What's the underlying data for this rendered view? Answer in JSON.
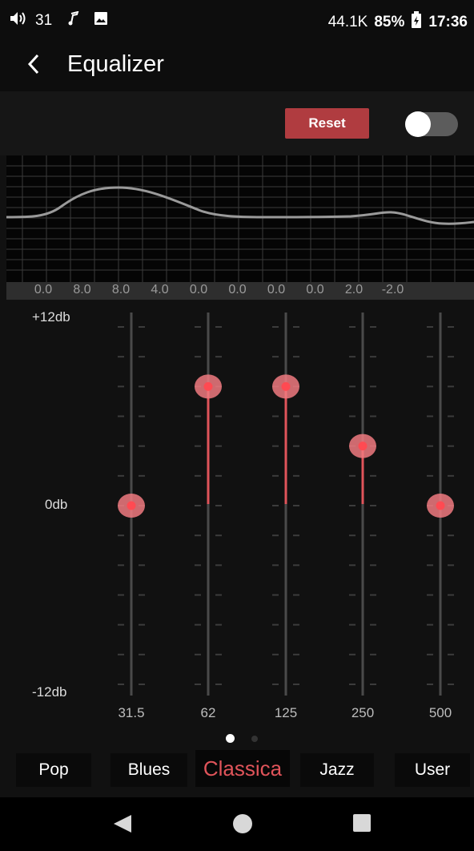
{
  "status_bar": {
    "volume_level": "31",
    "network_rate": "44.1K",
    "battery_percent": "85%",
    "time": "17:36",
    "icons": [
      "volume-icon",
      "music-note-icon",
      "image-icon",
      "battery-charging-icon"
    ]
  },
  "app_bar": {
    "title": "Equalizer",
    "back_icon": "chevron-left-icon"
  },
  "controls": {
    "reset_label": "Reset",
    "eq_enabled": false
  },
  "eq_curve": {
    "gain_labels": [
      "0.0",
      "8.0",
      "8.0",
      "4.0",
      "0.0",
      "0.0",
      "0.0",
      "0.0",
      "2.0",
      "-2.0"
    ]
  },
  "scale": {
    "max_label": "+12db",
    "mid_label": "0db",
    "min_label": "-12db",
    "max_db": 12,
    "min_db": -12
  },
  "bands": [
    {
      "freq": "31.5",
      "gain_db": 0
    },
    {
      "freq": "62",
      "gain_db": 8
    },
    {
      "freq": "125",
      "gain_db": 8
    },
    {
      "freq": "250",
      "gain_db": 4
    },
    {
      "freq": "500",
      "gain_db": 0
    }
  ],
  "pager": {
    "pages": 2,
    "current": 0
  },
  "presets": {
    "items": [
      "Pop",
      "Blues",
      "Classica",
      "Jazz",
      "User"
    ],
    "selected_index": 2
  },
  "colors": {
    "accent": "#e0545a",
    "reset_bg": "#b03c40",
    "knob_outer": "#f07a80",
    "knob_inner": "#ff4a52",
    "track": "#4a4a4a",
    "curve": "#9a9a9a"
  },
  "nav": {
    "icons": [
      "back-triangle-icon",
      "home-circle-icon",
      "recents-square-icon"
    ]
  }
}
